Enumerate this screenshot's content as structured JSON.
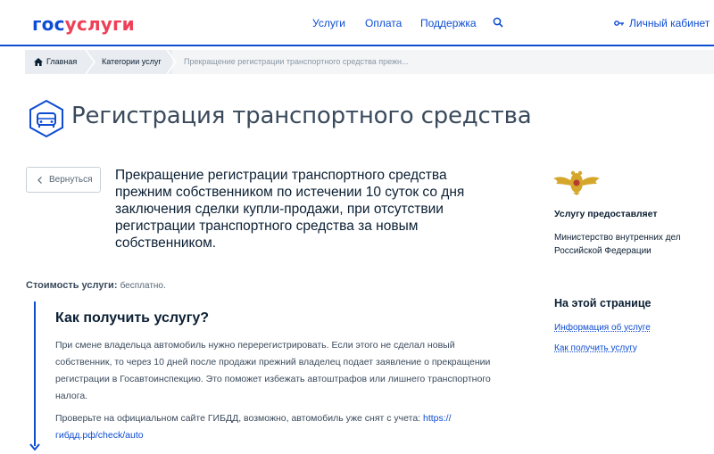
{
  "header": {
    "logo_part1": "гос",
    "logo_part2": "услуги",
    "nav": [
      "Услуги",
      "Оплата",
      "Поддержка"
    ],
    "cabinet_label": "Личный кабинет"
  },
  "breadcrumb": {
    "home": "Главная",
    "category": "Категории услуг",
    "current": "Прекращение регистрации транспортного средства прежн..."
  },
  "page_title": "Регистрация транспортного средства",
  "back_label": "Вернуться",
  "service_name": "Прекращение регистрации транспортного средства прежним собственником по истечении 10 суток со дня заключения сделки купли-продажи, при отсутствии регистрации транспортного средства за новым собственником.",
  "cost": {
    "label": "Стоимость услуги:",
    "value": "бесплатно."
  },
  "how": {
    "title": "Как получить услугу?",
    "paragraph1": "При смене владельца автомобиль нужно перерегистрировать. Если этого не сделал новый собственник, то через 10 дней после продажи прежний владелец подает заявление о прекращении регистрации в Госавтоинспекцию. Это поможет избежать автоштрафов или лишнего транспортного налога.",
    "paragraph2_text": "Проверьте на официальном сайте ГИБДД, возможно, автомобиль уже снят с учета: ",
    "paragraph2_link": "https://гибдд.рф/check/auto"
  },
  "sidebar": {
    "provider_title": "Услугу предоставляет",
    "provider_name": "Министерство внутренних дел Российской Федерации",
    "onpage_title": "На этой странице",
    "onpage_links": [
      "Информация об услуге",
      "Как получить услугу"
    ]
  },
  "colors": {
    "brand_blue": "#0d4cd3",
    "brand_red": "#ee3f58",
    "emblem_gold": "#d4a62a"
  }
}
